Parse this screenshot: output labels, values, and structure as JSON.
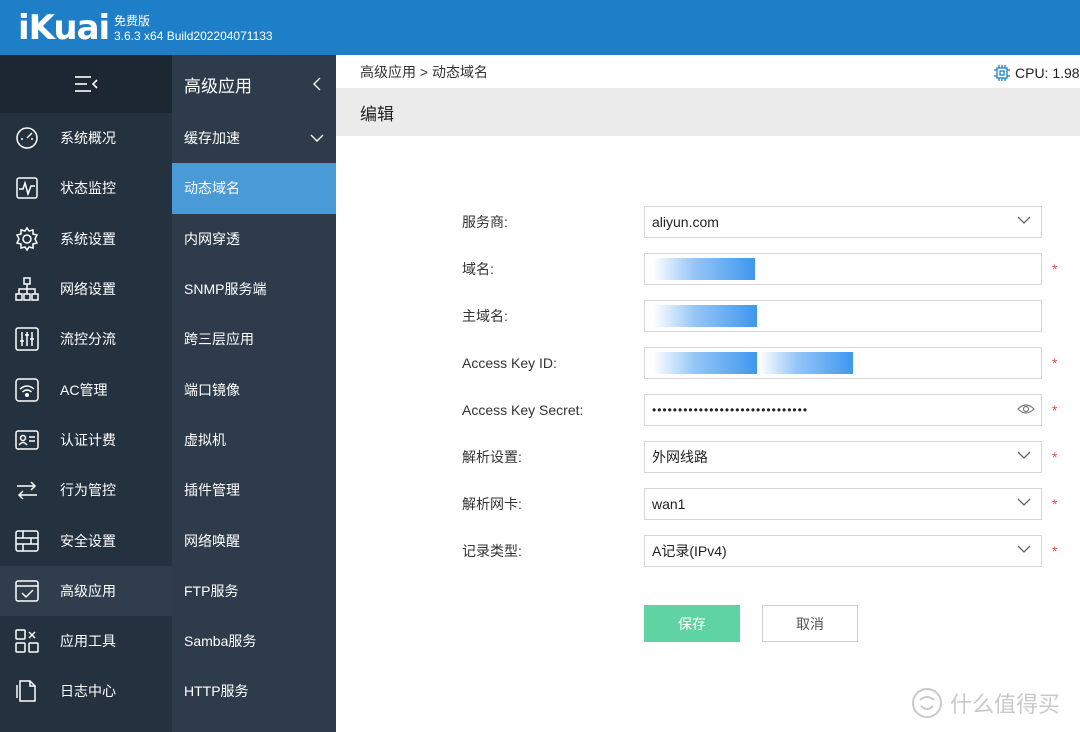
{
  "header": {
    "logo": "iKuai",
    "edition": "免费版",
    "version": "3.6.3 x64 Build202204071133"
  },
  "sidebar": {
    "items": [
      {
        "label": "系统概况",
        "icon": "dashboard-icon"
      },
      {
        "label": "状态监控",
        "icon": "monitor-icon"
      },
      {
        "label": "系统设置",
        "icon": "gear-icon"
      },
      {
        "label": "网络设置",
        "icon": "network-icon"
      },
      {
        "label": "流控分流",
        "icon": "sliders-icon"
      },
      {
        "label": "AC管理",
        "icon": "wifi-icon"
      },
      {
        "label": "认证计费",
        "icon": "id-card-icon"
      },
      {
        "label": "行为管控",
        "icon": "arrows-icon"
      },
      {
        "label": "安全设置",
        "icon": "firewall-icon"
      },
      {
        "label": "高级应用",
        "icon": "checkbox-icon",
        "active": true
      },
      {
        "label": "应用工具",
        "icon": "tools-icon"
      },
      {
        "label": "日志中心",
        "icon": "document-icon"
      }
    ]
  },
  "subnav": {
    "title": "高级应用",
    "items": [
      {
        "label": "缓存加速",
        "expandable": true
      },
      {
        "label": "动态域名",
        "active": true
      },
      {
        "label": "内网穿透"
      },
      {
        "label": "SNMP服务端"
      },
      {
        "label": "跨三层应用"
      },
      {
        "label": "端口镜像"
      },
      {
        "label": "虚拟机"
      },
      {
        "label": "插件管理"
      },
      {
        "label": "网络唤醒"
      },
      {
        "label": "FTP服务"
      },
      {
        "label": "Samba服务"
      },
      {
        "label": "HTTP服务"
      }
    ]
  },
  "breadcrumb": "高级应用 > 动态域名",
  "cpu": "CPU: 1.98",
  "page_title": "编辑",
  "form": {
    "provider": {
      "label": "服务商:",
      "value": "aliyun.com"
    },
    "domain": {
      "label": "域名:",
      "value": ""
    },
    "main_domain": {
      "label": "主域名:",
      "value": ""
    },
    "access_key_id": {
      "label": "Access Key ID:",
      "value": ""
    },
    "access_key_secret": {
      "label": "Access Key Secret:",
      "value": "••••••••••••••••••••••••••••••"
    },
    "resolve_setting": {
      "label": "解析设置:",
      "value": "外网线路"
    },
    "resolve_nic": {
      "label": "解析网卡:",
      "value": "wan1"
    },
    "record_type": {
      "label": "记录类型:",
      "value": "A记录(IPv4)"
    },
    "required_mark": "*"
  },
  "buttons": {
    "save": "保存",
    "cancel": "取消"
  },
  "watermark": "什么值得买",
  "colors": {
    "header": "#1e7fc8",
    "nav_dark": "#24313f",
    "nav_active": "#4a9ad8",
    "save_button": "#5fd3a2",
    "required": "#e84c4c"
  }
}
